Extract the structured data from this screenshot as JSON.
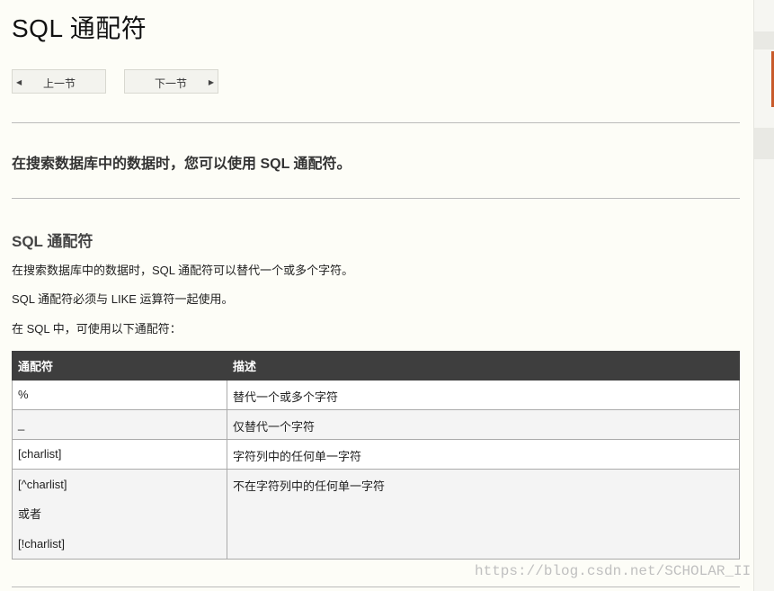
{
  "page": {
    "title": "SQL 通配符",
    "intro": "在搜索数据库中的数据时，您可以使用 SQL 通配符。",
    "section_title": "SQL 通配符",
    "paragraphs": [
      "在搜索数据库中的数据时，SQL 通配符可以替代一个或多个字符。",
      "SQL 通配符必须与 LIKE 运算符一起使用。",
      "在 SQL 中，可使用以下通配符："
    ]
  },
  "nav": {
    "prev_label": "上一节",
    "next_label": "下一节",
    "prev_icon": "left-triangle-icon",
    "next_icon": "right-triangle-icon"
  },
  "table": {
    "headers": [
      "通配符",
      "描述"
    ],
    "rows": [
      {
        "wildcard": "%",
        "desc": "替代一个或多个字符"
      },
      {
        "wildcard": "_",
        "desc": "仅替代一个字符"
      },
      {
        "wildcard": "[charlist]",
        "desc": "字符列中的任何单一字符"
      },
      {
        "wildcard_lines": [
          "[^charlist]",
          "或者",
          "[!charlist]"
        ],
        "desc": "不在字符列中的任何单一字符"
      }
    ]
  },
  "watermark": "https://blog.csdn.net/SCHOLAR_II",
  "colors": {
    "background": "#fdfdf7",
    "table_header": "#3e3e3e",
    "sidebar_accent": "#c85a2a"
  }
}
